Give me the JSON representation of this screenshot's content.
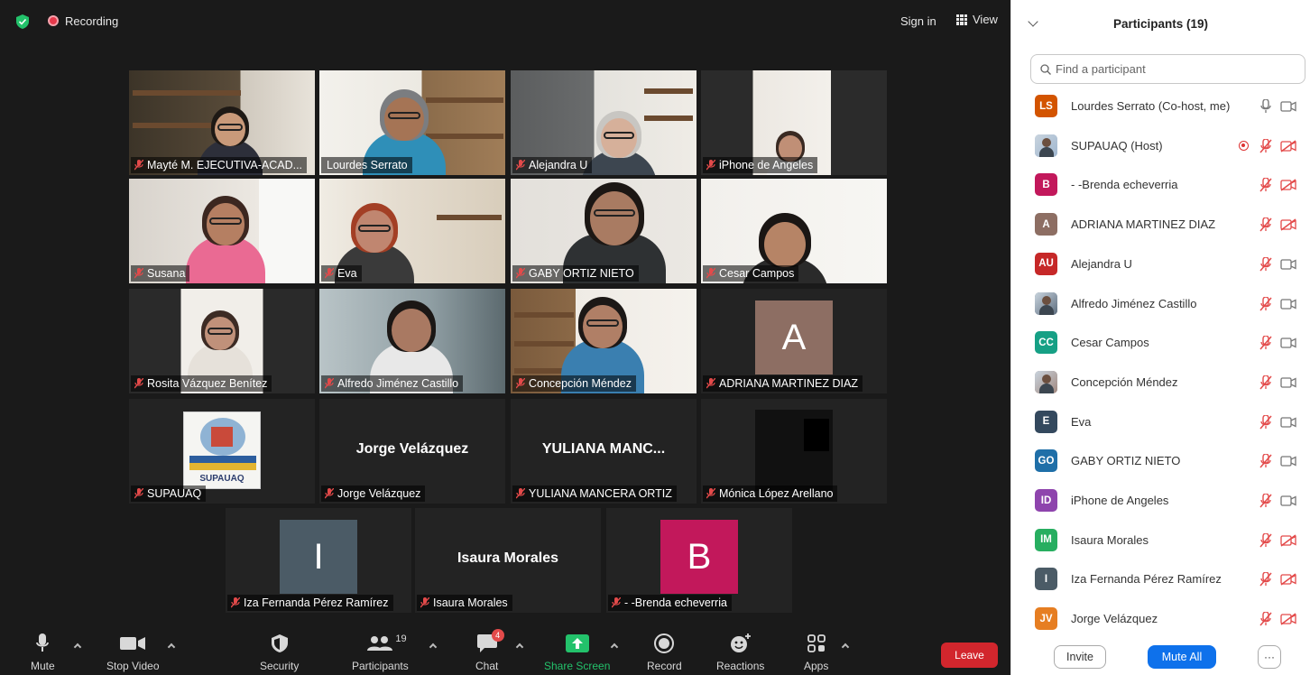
{
  "topbar": {
    "recording_label": "Recording",
    "signin_label": "Sign in",
    "view_label": "View"
  },
  "tiles": [
    {
      "name": "Mayté M. EJECUTIVA-ACAD...",
      "type": "video",
      "muted": true
    },
    {
      "name": "Lourdes Serrato",
      "type": "video",
      "muted": false,
      "active_speaker": true
    },
    {
      "name": "Alejandra U",
      "type": "video",
      "muted": true
    },
    {
      "name": "iPhone de Angeles",
      "type": "video",
      "muted": true
    },
    {
      "name": "Susana",
      "type": "video",
      "muted": true
    },
    {
      "name": "Eva",
      "type": "video",
      "muted": true
    },
    {
      "name": "GABY ORTIZ NIETO",
      "type": "video",
      "muted": true
    },
    {
      "name": "Cesar Campos",
      "type": "video",
      "muted": true
    },
    {
      "name": "Rosita Vázquez Benítez",
      "type": "video",
      "muted": true
    },
    {
      "name": "Alfredo Jiménez Castillo",
      "type": "video",
      "muted": true
    },
    {
      "name": "Concepción Méndez",
      "type": "video",
      "muted": true
    },
    {
      "name": "ADRIANA MARTINEZ DIAZ",
      "type": "avatar",
      "letter": "A",
      "color": "#8d6e63",
      "muted": true
    },
    {
      "name": "SUPAUAQ",
      "type": "logo",
      "logo_text": "SUPAUAQ",
      "muted": true
    },
    {
      "name": "Jorge Velázquez",
      "type": "name",
      "display": "Jorge Velázquez",
      "muted": true
    },
    {
      "name": "YULIANA MANCERA ORTIZ",
      "type": "name",
      "display": "YULIANA MANC...",
      "muted": true
    },
    {
      "name": "Mónica López Arellano",
      "type": "video",
      "muted": true
    },
    {
      "name": "Iza Fernanda Pérez Ramírez",
      "type": "avatar",
      "letter": "I",
      "color": "#4b5b66",
      "muted": true
    },
    {
      "name": "Isaura Morales",
      "type": "name",
      "display": "Isaura Morales",
      "muted": true
    },
    {
      "name": "- -Brenda echeverria",
      "type": "avatar",
      "letter": "B",
      "color": "#c2185b",
      "muted": true
    }
  ],
  "toolbar": {
    "mute": "Mute",
    "stop_video": "Stop Video",
    "security": "Security",
    "participants": "Participants",
    "participants_count": "19",
    "chat": "Chat",
    "chat_badge": "4",
    "share_screen": "Share Screen",
    "record": "Record",
    "reactions": "Reactions",
    "apps": "Apps",
    "leave": "Leave"
  },
  "panel": {
    "title": "Participants (19)",
    "search_placeholder": "Find a participant",
    "participants": [
      {
        "initials": "LS",
        "name": "Lourdes Serrato (Co-host, me)",
        "color": "#d35400",
        "mic": "on",
        "video": "on"
      },
      {
        "initials": "",
        "name": "SUPAUAQ (Host)",
        "color": "#9fb6cf",
        "mic": "muted",
        "video": "off",
        "recording": true,
        "image": true
      },
      {
        "initials": "B",
        "name": "- -Brenda echeverria",
        "color": "#c2185b",
        "mic": "muted",
        "video": "off"
      },
      {
        "initials": "A",
        "name": "ADRIANA MARTINEZ DIAZ",
        "color": "#8d6e63",
        "mic": "muted",
        "video": "off"
      },
      {
        "initials": "AU",
        "name": "Alejandra U",
        "color": "#c62828",
        "mic": "muted",
        "video": "on"
      },
      {
        "initials": "",
        "name": "Alfredo Jiménez Castillo",
        "color": "#5d6d7e",
        "mic": "muted",
        "video": "on",
        "image": true
      },
      {
        "initials": "CC",
        "name": "Cesar Campos",
        "color": "#16a085",
        "mic": "muted",
        "video": "on"
      },
      {
        "initials": "",
        "name": "Concepción Méndez",
        "color": "#a1887f",
        "mic": "muted",
        "video": "on",
        "image": true
      },
      {
        "initials": "E",
        "name": "Eva",
        "color": "#34495e",
        "mic": "muted",
        "video": "on"
      },
      {
        "initials": "GO",
        "name": "GABY ORTIZ NIETO",
        "color": "#1f6fa8",
        "mic": "muted",
        "video": "on"
      },
      {
        "initials": "ID",
        "name": "iPhone de Angeles",
        "color": "#8e44ad",
        "mic": "muted",
        "video": "on"
      },
      {
        "initials": "IM",
        "name": "Isaura Morales",
        "color": "#27ae60",
        "mic": "muted",
        "video": "off"
      },
      {
        "initials": "I",
        "name": "Iza Fernanda Pérez Ramírez",
        "color": "#4b5b66",
        "mic": "muted",
        "video": "off"
      },
      {
        "initials": "JV",
        "name": "Jorge Velázquez",
        "color": "#e67e22",
        "mic": "muted",
        "video": "off"
      }
    ],
    "invite_label": "Invite",
    "mute_all_label": "Mute All",
    "more_label": "···"
  }
}
